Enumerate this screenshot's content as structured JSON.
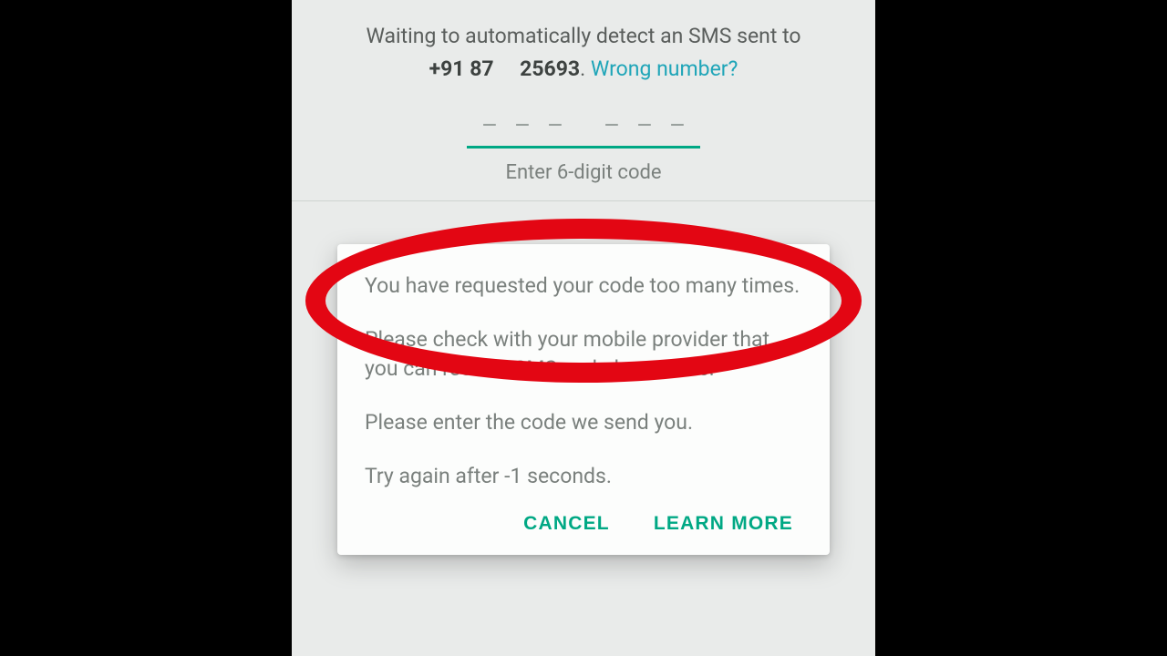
{
  "header": {
    "waiting_prefix": "Waiting to automatically detect an SMS sent to",
    "phone_part1": "+91 87",
    "phone_part2": "25693",
    "phone_suffix": ".",
    "wrong_number": "Wrong number?"
  },
  "code_input": {
    "placeholder_dash": "–",
    "hint": "Enter 6-digit code"
  },
  "dialog": {
    "para1": "You have requested your code too many times.",
    "para2": "Please check with your mobile provider that you can receive SMS and phone calls.",
    "para3": "Please enter the code we send you.",
    "para4": "Try again after -1 seconds.",
    "cancel": "CANCEL",
    "learn_more": "LEARN MORE"
  },
  "colors": {
    "accent": "#00a884",
    "link": "#1fa5b8",
    "highlight": "#e30613"
  }
}
